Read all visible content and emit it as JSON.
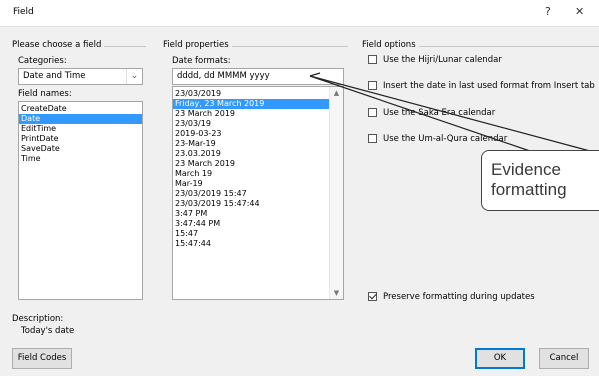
{
  "window": {
    "title": "Field",
    "help_label": "?",
    "close_label": "✕"
  },
  "choose_field": {
    "group_label": "Please choose a field",
    "categories_label": "Categories:",
    "categories_value": "Date and Time",
    "field_names_label": "Field names:",
    "field_names": [
      "CreateDate",
      "Date",
      "EditTime",
      "PrintDate",
      "SaveDate",
      "Time"
    ],
    "selected_index": 1
  },
  "field_properties": {
    "group_label": "Field properties",
    "date_formats_label": "Date formats:",
    "date_format_value": "dddd, dd MMMM yyyy",
    "date_formats": [
      "23/03/2019",
      "Friday, 23 March 2019",
      "23 March 2019",
      "23/03/19",
      "2019-03-23",
      "23-Mar-19",
      "23.03.2019",
      "23 March 2019",
      "March 19",
      "Mar-19",
      "23/03/2019 15:47",
      "23/03/2019 15:47:44",
      "3:47 PM",
      "3:47:44 PM",
      "15:47",
      "15:47:44"
    ],
    "selected_index": 1
  },
  "field_options": {
    "group_label": "Field options",
    "checkboxes": [
      {
        "label": "Use the Hijri/Lunar calendar",
        "checked": false
      },
      {
        "label": "Insert the date in last used format from Insert tab",
        "checked": false
      },
      {
        "label": "Use the Saka Era calendar",
        "checked": false
      },
      {
        "label": "Use the Um-al-Qura calendar",
        "checked": false
      }
    ],
    "preserve_label": "Preserve formatting during updates",
    "preserve_checked": true
  },
  "description": {
    "label": "Description:",
    "text": "Today's date"
  },
  "buttons": {
    "field_codes": "Field Codes",
    "ok": "OK",
    "cancel": "Cancel"
  },
  "callout": {
    "line1": "Evidence",
    "line2": "formatting"
  },
  "colors": {
    "selection": "#3399ff",
    "dialog_bg": "#f0f0f0"
  }
}
